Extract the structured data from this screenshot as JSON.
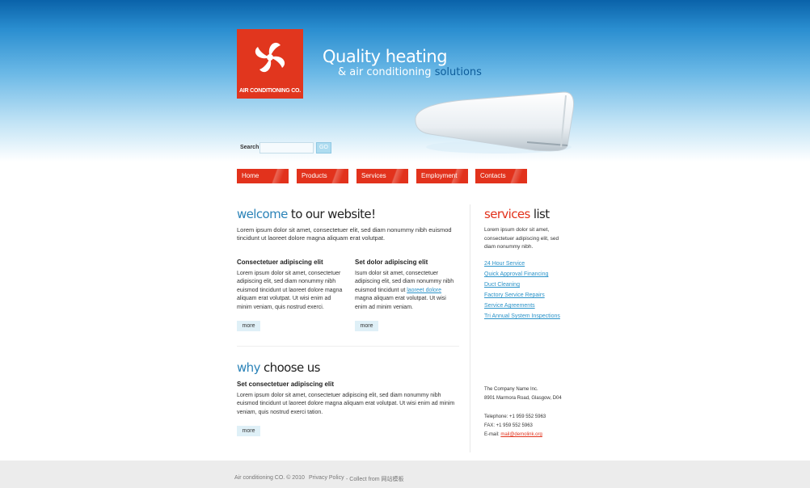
{
  "brand": {
    "logo_text": "AIR CONDITIONING CO.",
    "tagline_main": "Quality heating",
    "tagline_sub_prefix": "& air conditioning",
    "tagline_sub_highlight": "solutions"
  },
  "search": {
    "label": "Search:",
    "value": "",
    "button_label": "GO"
  },
  "nav": [
    {
      "label": "Home"
    },
    {
      "label": "Products"
    },
    {
      "label": "Services"
    },
    {
      "label": "Employment"
    },
    {
      "label": "Contacts"
    }
  ],
  "welcome": {
    "title_a": "welcome",
    "title_b": "to our website!",
    "intro": "Lorem ipsum dolor sit amet, consectetuer elit, sed diam nonummy nibh euismod tincidunt ut laoreet dolore magna aliquam erat volutpat.",
    "col1_title": "Consectetuer adipiscing elit",
    "col1_text": "Lorem ipsum dolor sit amet, consectetuer adipiscing elit, sed diam nonummy nibh euismod tincidunt ut laoreet dolore magna aliquam erat volutpat. Ut wisi enim ad minim veniam, quis nostrud exerci.",
    "col1_more": "more",
    "col2_title": "Set dolor adipiscing elit",
    "col2_text_a": "Isum dolor sit amet, consectetuer adipiscing elit, sed diam nonummy nibh euismod tincidunt ut",
    "col2_link": "laoreet dolore",
    "col2_text_b": "magna aliquam erat volutpat. Ut wisi enim ad minim veniam.",
    "col2_more": "more"
  },
  "why": {
    "title_a": "why",
    "title_b": "choose us",
    "subtitle": "Set consectetuer adipiscing elit",
    "text": "Lorem ipsum dolor sit amet, consectetuer adipiscing elit, sed diam nonummy nibh euismod tincidunt ut laoreet dolore magna aliquam erat volutpat. Ut wisi enim ad minim veniam, quis nostrud exerci tation.",
    "more": "more"
  },
  "services": {
    "title_a": "services",
    "title_b": "list",
    "intro": "Lorem ipsum dolor sit amet, consectetuer adipiscing elit, sed diam nonummy nibh.",
    "links": [
      {
        "label": "24 Hour Service"
      },
      {
        "label": "Quick Approval Financing"
      },
      {
        "label": "Duct Cleaning"
      },
      {
        "label": "Factory Service Repairs"
      },
      {
        "label": "Service Agreements"
      },
      {
        "label": "Tri Annual System Inspections"
      }
    ]
  },
  "contact": {
    "company": "The Company Name Inc.",
    "address": "8901 Marmora Road, Glasgow, D04",
    "telephone": "Telephone: +1 959 552 5963",
    "fax": "FAX: +1 959 552 5963",
    "email_label": "E-mail:",
    "email": "mail@demolink.org"
  },
  "footer": {
    "copyright": "Air conditioning CO. © 2010",
    "privacy": "Privacy Policy",
    "collect": "- Collect from 网站模板"
  },
  "colors": {
    "accent_red": "#e2321c",
    "accent_blue": "#2b83b8",
    "header_blue": "#0a62a9"
  }
}
